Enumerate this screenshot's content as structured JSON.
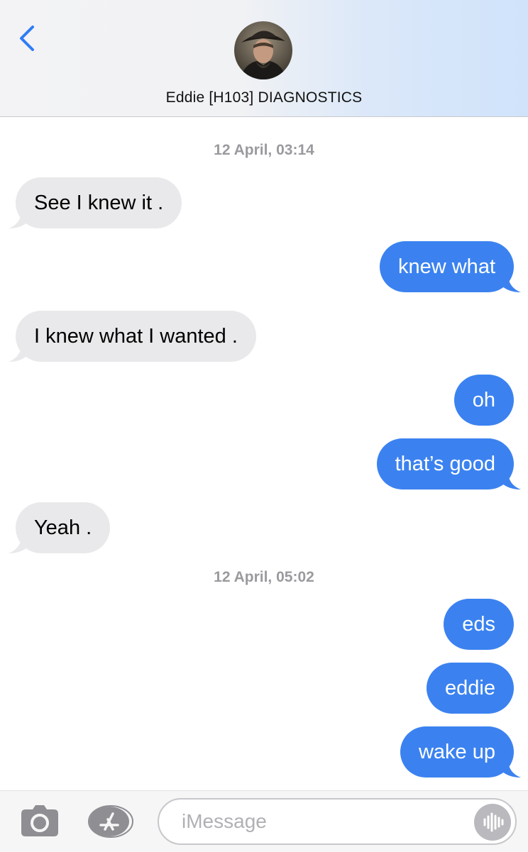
{
  "header": {
    "contact_name": "Eddie [H103] DIAGNOSTICS",
    "back_icon": "chevron-left-icon",
    "accent_color": "#2f7cf6"
  },
  "conversation": {
    "timestamps": [
      "12 April, 03:14",
      "12 April, 05:02"
    ],
    "messages": [
      {
        "direction": "incoming",
        "text": "See I knew it ."
      },
      {
        "direction": "outgoing",
        "text": "knew what"
      },
      {
        "direction": "incoming",
        "text": "I knew what I wanted ."
      },
      {
        "direction": "outgoing",
        "text": "oh"
      },
      {
        "direction": "outgoing",
        "text": "that’s good"
      },
      {
        "direction": "incoming",
        "text": "Yeah ."
      },
      {
        "direction": "outgoing",
        "text": "eds"
      },
      {
        "direction": "outgoing",
        "text": "eddie"
      },
      {
        "direction": "outgoing",
        "text": "wake up"
      }
    ],
    "incoming_color": "#e9e9eb",
    "outgoing_color": "#3b82f0"
  },
  "input_bar": {
    "placeholder": "iMessage",
    "icons": [
      "camera-icon",
      "app-store-icon",
      "audio-waveform-icon"
    ]
  }
}
